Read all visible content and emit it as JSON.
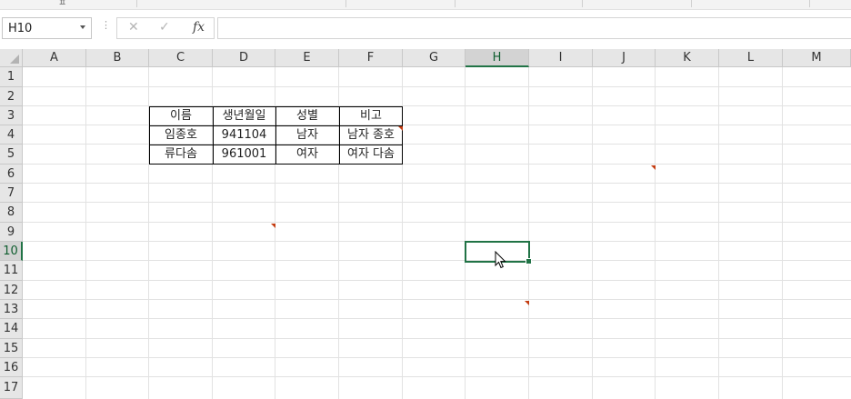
{
  "name_box": {
    "value": "H10"
  },
  "formula_bar": {
    "fx_label": "fx",
    "cancel_glyph": "✕",
    "enter_glyph": "✓",
    "content": ""
  },
  "columns": [
    "A",
    "B",
    "C",
    "D",
    "E",
    "F",
    "G",
    "H",
    "I",
    "J",
    "K",
    "L",
    "M"
  ],
  "rows": [
    "1",
    "2",
    "3",
    "4",
    "5",
    "6",
    "7",
    "8",
    "9",
    "10",
    "11",
    "12",
    "13",
    "14",
    "15",
    "16",
    "17"
  ],
  "active_cell": {
    "column": "H",
    "row": "10"
  },
  "table": {
    "headers": [
      "이름",
      "생년월일",
      "성별",
      "비고"
    ],
    "rows": [
      [
        "임종호",
        "941104",
        "남자",
        "남자 종호"
      ],
      [
        "류다솜",
        "961001",
        "여자",
        "여자 다솜"
      ]
    ]
  },
  "colors": {
    "accent": "#217346",
    "comment_marker": "#c43d12"
  }
}
